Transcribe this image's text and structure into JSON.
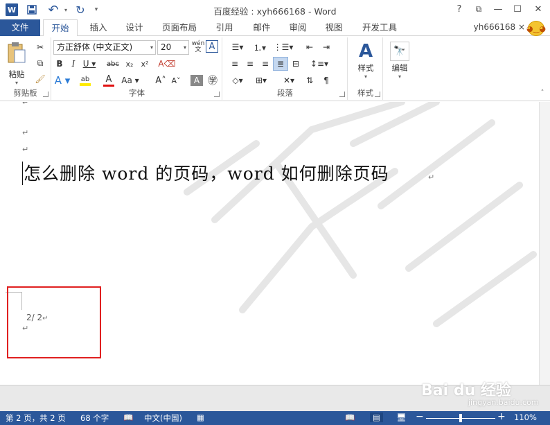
{
  "title": "百度经验 : xyh666168 - Word",
  "qat": {
    "undo": "↶",
    "redo": "↻"
  },
  "window": {
    "help": "?",
    "restore": "⧉",
    "minimize": "—",
    "maximize": "☐",
    "close": "✕"
  },
  "tabs": [
    "文件",
    "开始",
    "插入",
    "设计",
    "页面布局",
    "引用",
    "邮件",
    "审阅",
    "视图",
    "开发工具"
  ],
  "user": "yh666168 ×",
  "ribbon": {
    "clipboard": {
      "label": "剪贴板",
      "paste": "粘贴"
    },
    "font": {
      "label": "字体",
      "font_name": "方正舒体 (中文正文)",
      "font_size": "20",
      "wen": "wén"
    },
    "paragraph": {
      "label": "段落"
    },
    "styles": {
      "label": "样式",
      "button": "样式"
    },
    "editing": {
      "button": "编辑"
    }
  },
  "document": {
    "heading": "怎么删除 word 的页码，word 如何删除页码",
    "return_mark": "↵",
    "page_number": "2/ 2"
  },
  "status": {
    "page": "第 2 页，共 2 页",
    "words": "68 个字",
    "language": "中文(中国)",
    "zoom": "110%",
    "zoom_fraction": 0.5
  },
  "watermark": {
    "brand": "Bai du 经验",
    "url": "jingyan.baidu.com"
  }
}
